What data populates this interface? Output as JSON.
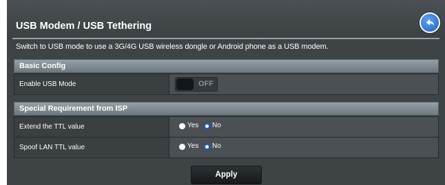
{
  "header": {
    "title": "USB Modem / USB Tethering",
    "description": "Switch to USB mode to use a 3G/4G USB wireless dongle or Android phone as a USB modem."
  },
  "basic_config": {
    "heading": "Basic Config",
    "enable_usb_mode": {
      "label": "Enable USB Mode",
      "state": "OFF"
    }
  },
  "isp_requirements": {
    "heading": "Special Requirement from ISP",
    "extend_ttl": {
      "label": "Extend the TTL value",
      "yes": "Yes",
      "no": "No",
      "selected": "No"
    },
    "spoof_lan_ttl": {
      "label": "Spoof LAN TTL value",
      "yes": "Yes",
      "no": "No",
      "selected": "No"
    }
  },
  "actions": {
    "apply": "Apply"
  },
  "icons": {
    "back": "back-arrow-icon"
  },
  "colors": {
    "accent": "#1a5ed8",
    "back_button": "#2f7ae0"
  }
}
